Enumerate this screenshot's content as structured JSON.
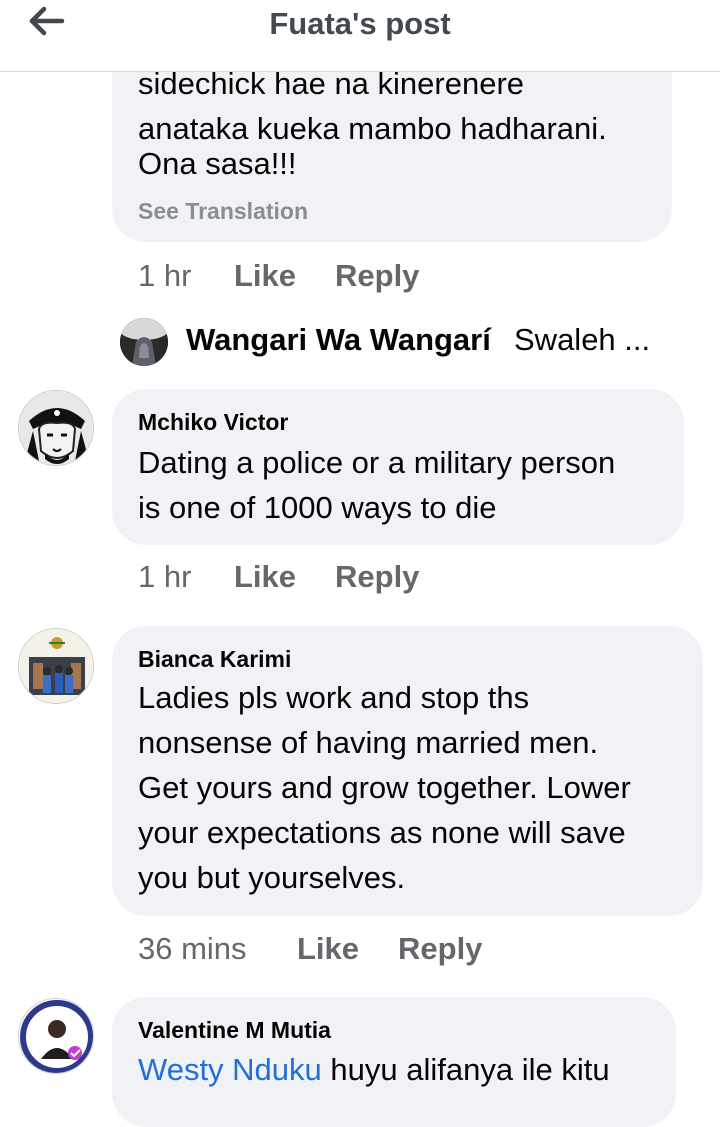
{
  "header": {
    "title": "Fuata's post"
  },
  "comments": [
    {
      "lines": [
        "sidechick hae na kinerenere",
        "anataka kueka mambo hadharani.",
        "Ona sasa!!!"
      ],
      "see_translation": "See Translation",
      "time": "1 hr",
      "like": "Like",
      "reply": "Reply"
    },
    {
      "author": "Mchiko Victor",
      "lines": [
        "Dating a police or a military person",
        "is one of 1000 ways to die"
      ],
      "time": "1 hr",
      "like": "Like",
      "reply": "Reply"
    },
    {
      "author": "Bianca Karimi",
      "lines": [
        "Ladies pls work and stop ths",
        "nonsense of having married men.",
        "Get yours and grow together. Lower",
        "your expectations as none will save",
        "you but yourselves."
      ],
      "time": "36 mins",
      "like": "Like",
      "reply": "Reply"
    },
    {
      "author": "Valentine M Mutia",
      "mention": "Westy Nduku",
      "text_after_mention": " huyu alifanya ile kitu"
    }
  ],
  "reply_preview": {
    "author": "Wangari Wa Wangarí",
    "snippet": "Swaleh ..."
  },
  "colors": {
    "bubble": "#f0f2f5",
    "secondary_text": "#65676b",
    "link": "#216fdb",
    "header_title": "#444950"
  },
  "icons": {
    "back": "arrow-left-icon"
  }
}
